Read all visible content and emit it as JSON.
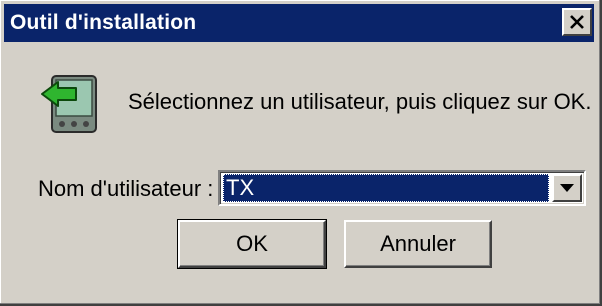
{
  "window": {
    "title": "Outil d'installation",
    "close_icon": "close-icon",
    "app_icon": "hotsync-install-icon"
  },
  "content": {
    "message": "Sélectionnez un utilisateur, puis cliquez sur OK.",
    "user_label": "Nom d'utilisateur :",
    "user_select": {
      "selected_value": "TX",
      "dropdown_icon": "chevron-down-icon"
    }
  },
  "buttons": {
    "ok_label": "OK",
    "cancel_label": "Annuler"
  },
  "colors": {
    "titlebar": "#0a246a",
    "selection": "#0a246a",
    "face": "#d4d0c8"
  }
}
